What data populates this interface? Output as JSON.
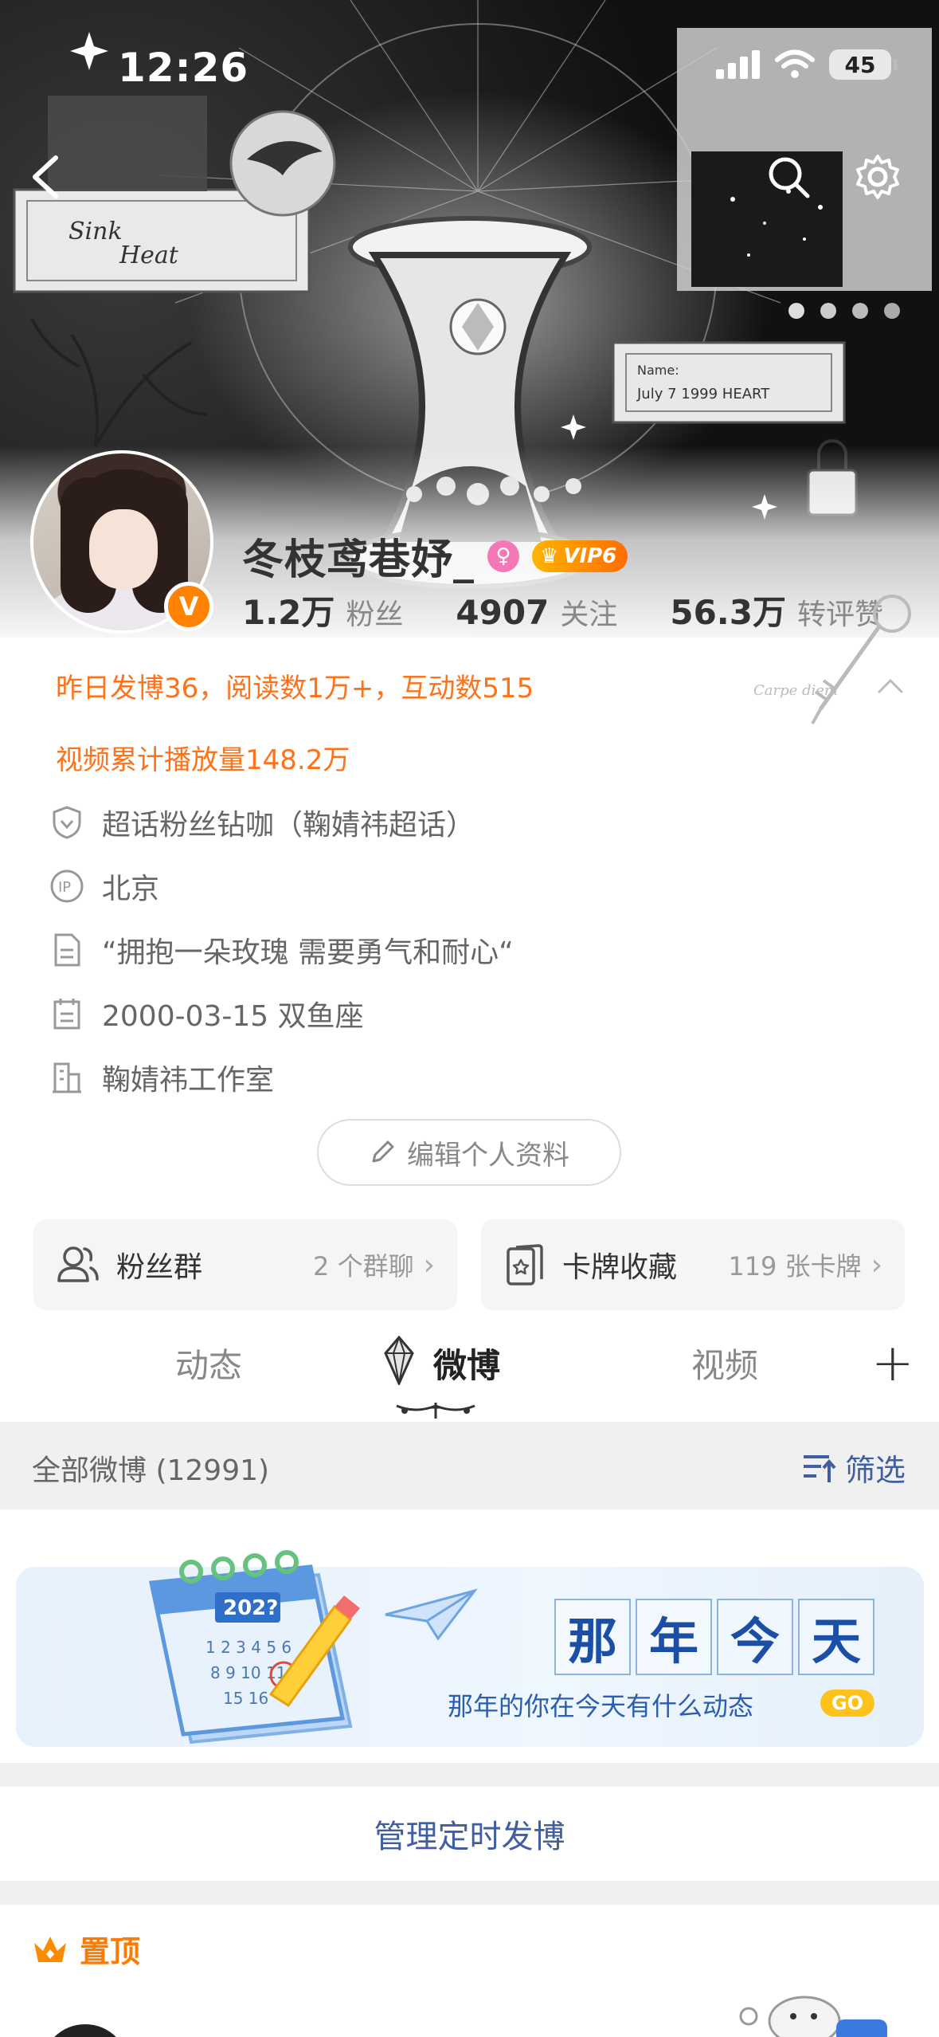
{
  "status_bar": {
    "time": "12:26",
    "battery": "45"
  },
  "profile": {
    "name": "冬枝鸢巷妤_",
    "vip_label": "VIP6",
    "verified_mark": "V",
    "stats": [
      {
        "num": "1.2万",
        "label": "粉丝"
      },
      {
        "num": "4907",
        "label": "关注"
      },
      {
        "num": "56.3万",
        "label": "转评赞"
      }
    ]
  },
  "highlights": {
    "line1": "昨日发博36，阅读数1万+，互动数515",
    "line2": "视频累计播放量148.2万"
  },
  "info": {
    "super_topic": "超话粉丝钻咖（鞠婧祎超话）",
    "ip": "北京",
    "bio": "“拥抱一朵玫瑰 需要勇气和耐心“",
    "birthday": "2000-03-15 双鱼座",
    "company": "鞠婧祎工作室"
  },
  "edit_profile_label": "编辑个人资料",
  "cards": {
    "fans_group": {
      "title": "粉丝群",
      "sub": "2 个群聊"
    },
    "card_collection": {
      "title": "卡牌收藏",
      "sub": "119 张卡牌"
    }
  },
  "tabs": {
    "feed": "动态",
    "weibo": "微博",
    "video": "视频",
    "add": "+"
  },
  "filter_bar": {
    "all": "全部微博 (12991)",
    "filter": "筛选"
  },
  "memory": {
    "title_chars": [
      "那",
      "年",
      "今",
      "天"
    ],
    "subtitle": "那年的你在今天有什么动态",
    "go": "GO",
    "calendar_year": "202?"
  },
  "manage_label": "管理定时发博",
  "pinned_label": "置顶",
  "colors": {
    "orange": "#ff7219",
    "link_blue": "#3f5f9f",
    "brand_orange": "#ff8200"
  }
}
